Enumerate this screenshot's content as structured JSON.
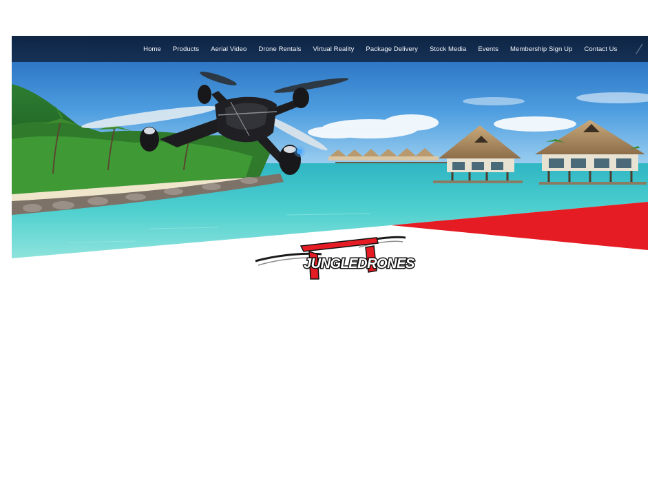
{
  "nav": {
    "items": [
      {
        "label": "Home",
        "name": "nav-home"
      },
      {
        "label": "Products",
        "name": "nav-products"
      },
      {
        "label": "Aerial Video",
        "name": "nav-aerial-video"
      },
      {
        "label": "Drone Rentals",
        "name": "nav-drone-rentals"
      },
      {
        "label": "Virtual Reality",
        "name": "nav-virtual-reality"
      },
      {
        "label": "Package Delivery",
        "name": "nav-package-delivery"
      },
      {
        "label": "Stock Media",
        "name": "nav-stock-media"
      },
      {
        "label": "Events",
        "name": "nav-events"
      },
      {
        "label": "Membership Sign Up",
        "name": "nav-membership-sign-up"
      },
      {
        "label": "Contact Us",
        "name": "nav-contact-us"
      }
    ]
  },
  "hero": {
    "image": "tropical-lagoon-with-drone"
  },
  "brand": {
    "logo_text": "JUNGLEDRONES",
    "colors": {
      "accent_red": "#e51c23",
      "nav_bg": "#0e2340",
      "logo_black": "#151515"
    }
  }
}
